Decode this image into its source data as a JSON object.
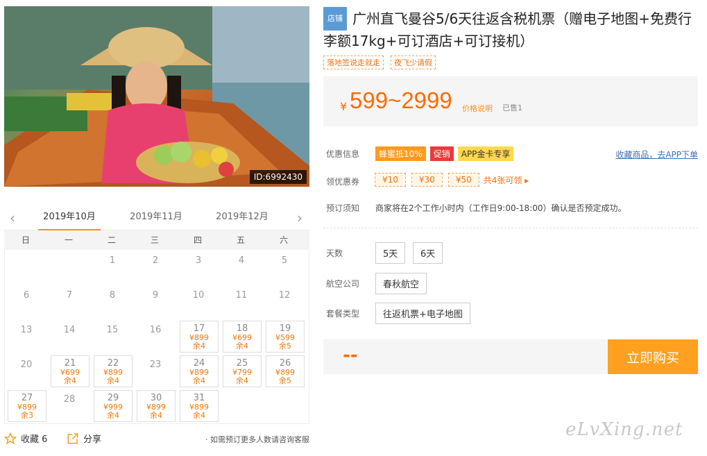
{
  "photo": {
    "id_label": "ID:6992430"
  },
  "calendar": {
    "months": [
      "2019年10月",
      "2019年11月",
      "2019年12月"
    ],
    "weekdays": [
      "日",
      "一",
      "二",
      "三",
      "四",
      "五",
      "六"
    ],
    "days": [
      {
        "d": ""
      },
      {
        "d": ""
      },
      {
        "d": "1"
      },
      {
        "d": "2"
      },
      {
        "d": "3"
      },
      {
        "d": "4"
      },
      {
        "d": "5"
      },
      {
        "d": "6"
      },
      {
        "d": "7"
      },
      {
        "d": "8"
      },
      {
        "d": "9"
      },
      {
        "d": "10"
      },
      {
        "d": "11"
      },
      {
        "d": "12"
      },
      {
        "d": "13"
      },
      {
        "d": "14"
      },
      {
        "d": "15"
      },
      {
        "d": "16"
      },
      {
        "d": "17",
        "p": "¥899",
        "r": "余4"
      },
      {
        "d": "18",
        "p": "¥699",
        "r": "余4"
      },
      {
        "d": "19",
        "p": "¥599",
        "r": "余5"
      },
      {
        "d": "20"
      },
      {
        "d": "21",
        "p": "¥699",
        "r": "余4"
      },
      {
        "d": "22",
        "p": "¥899",
        "r": "余4"
      },
      {
        "d": "23"
      },
      {
        "d": "24",
        "p": "¥899",
        "r": "余4"
      },
      {
        "d": "25",
        "p": "¥799",
        "r": "余4"
      },
      {
        "d": "26",
        "p": "¥899",
        "r": "余5"
      },
      {
        "d": "27",
        "p": "¥899",
        "r": "余3"
      },
      {
        "d": "28"
      },
      {
        "d": "29",
        "p": "¥999",
        "r": "余4"
      },
      {
        "d": "30",
        "p": "¥899",
        "r": "余4"
      },
      {
        "d": "31",
        "p": "¥899",
        "r": "余4"
      }
    ]
  },
  "footer": {
    "fav": "收藏 6",
    "share": "分享",
    "tip": "· 如需预订更多人数请咨询客服"
  },
  "product": {
    "shop_tag": "店铺",
    "title": "广州直飞曼谷5/6天往返含税机票（赠电子地图+免费行李额17kg+可订酒店+可订接机）",
    "tags": [
      "落地签说走就走",
      "夜飞少请假"
    ]
  },
  "price": {
    "currency": "¥",
    "amount": "599~2999",
    "explain": "价格说明",
    "sold": "已售1"
  },
  "promo": {
    "label": "优惠信息",
    "badges": [
      "蜂蜜抵10%",
      "促销",
      "APP金卡专享"
    ],
    "fav_link": "收藏商品，去APP下单"
  },
  "coupons": {
    "label": "领优惠券",
    "items": [
      "¥10",
      "¥30",
      "¥50"
    ],
    "more": "共4张可领 ▸"
  },
  "notice": {
    "label": "预订须知",
    "text": "商家将在2个工作小时内（工作日9:00-18:00）确认是否预定成功。"
  },
  "options": {
    "days_label": "天数",
    "days": [
      "5天",
      "6天"
    ],
    "airline_label": "航空公司",
    "airline": "春秋航空",
    "package_label": "套餐类型",
    "package": "往返机票+电子地图"
  },
  "buy": {
    "price_placeholder": "--",
    "button": "立即购买"
  },
  "watermark": "eLvXing.net"
}
